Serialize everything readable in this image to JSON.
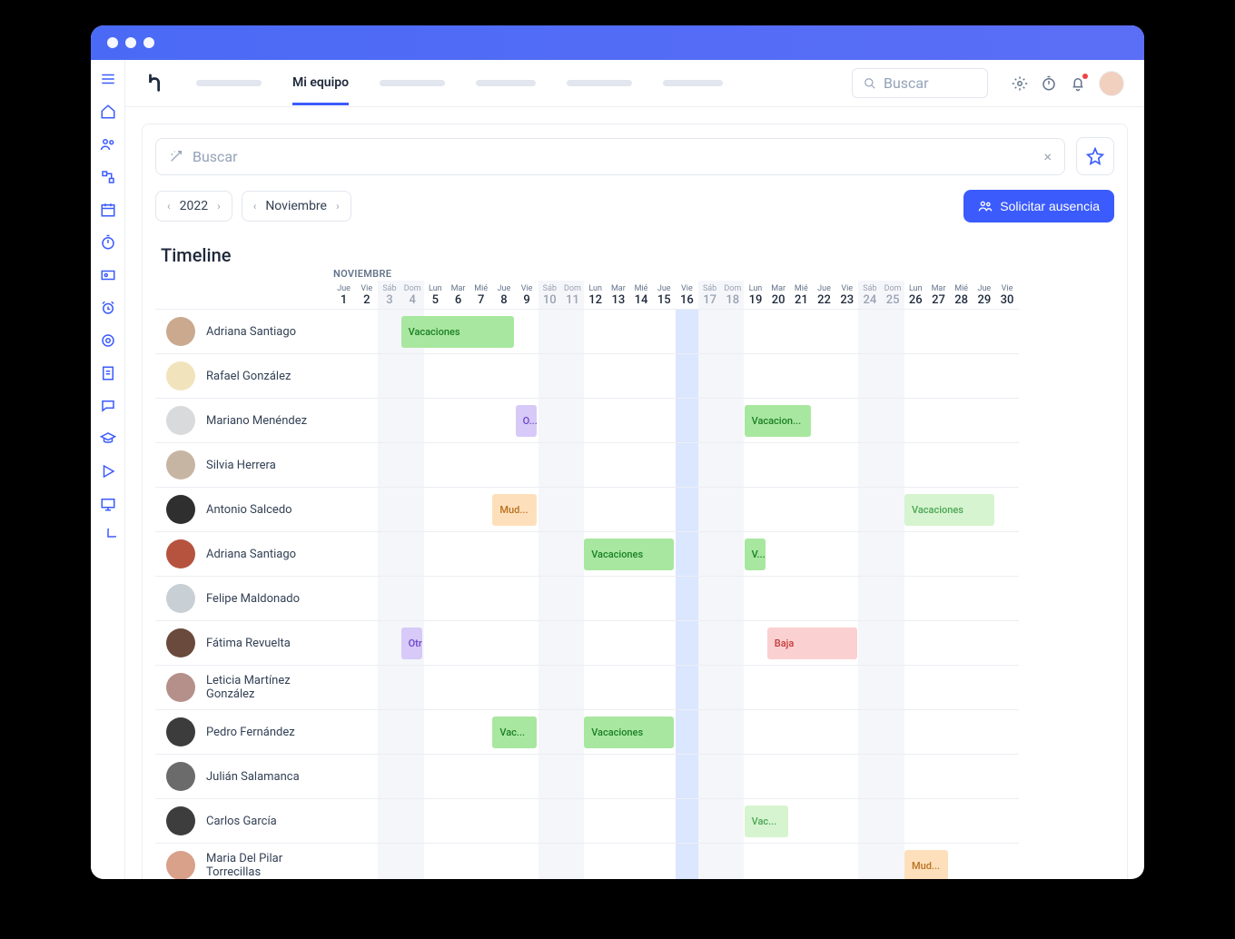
{
  "window": {
    "os_dots": 3
  },
  "topbar": {
    "active_tab": "Mi equipo",
    "search_placeholder": "Buscar"
  },
  "filters": {
    "search_placeholder": "Buscar",
    "year": "2022",
    "month": "Noviembre",
    "request_button": "Solicitar ausencia",
    "clear_glyph": "×"
  },
  "timeline": {
    "title": "Timeline",
    "month_header": "NOVIEMBRE",
    "today_index": 15,
    "days": [
      {
        "dow": "Jue",
        "num": "1",
        "weekend": false
      },
      {
        "dow": "Vie",
        "num": "2",
        "weekend": false
      },
      {
        "dow": "Sáb",
        "num": "3",
        "weekend": true
      },
      {
        "dow": "Dom",
        "num": "4",
        "weekend": true
      },
      {
        "dow": "Lun",
        "num": "5",
        "weekend": false
      },
      {
        "dow": "Mar",
        "num": "6",
        "weekend": false
      },
      {
        "dow": "Mié",
        "num": "7",
        "weekend": false
      },
      {
        "dow": "Jue",
        "num": "8",
        "weekend": false
      },
      {
        "dow": "Vie",
        "num": "9",
        "weekend": false
      },
      {
        "dow": "Sáb",
        "num": "10",
        "weekend": true
      },
      {
        "dow": "Dom",
        "num": "11",
        "weekend": true
      },
      {
        "dow": "Lun",
        "num": "12",
        "weekend": false
      },
      {
        "dow": "Mar",
        "num": "13",
        "weekend": false
      },
      {
        "dow": "Mié",
        "num": "14",
        "weekend": false
      },
      {
        "dow": "Jue",
        "num": "15",
        "weekend": false
      },
      {
        "dow": "Vie",
        "num": "16",
        "weekend": false
      },
      {
        "dow": "Sáb",
        "num": "17",
        "weekend": true
      },
      {
        "dow": "Dom",
        "num": "18",
        "weekend": true
      },
      {
        "dow": "Lun",
        "num": "19",
        "weekend": false
      },
      {
        "dow": "Mar",
        "num": "20",
        "weekend": false
      },
      {
        "dow": "Mié",
        "num": "21",
        "weekend": false
      },
      {
        "dow": "Jue",
        "num": "22",
        "weekend": false
      },
      {
        "dow": "Vie",
        "num": "23",
        "weekend": false
      },
      {
        "dow": "Sáb",
        "num": "24",
        "weekend": true
      },
      {
        "dow": "Dom",
        "num": "25",
        "weekend": true
      },
      {
        "dow": "Lun",
        "num": "26",
        "weekend": false
      },
      {
        "dow": "Mar",
        "num": "27",
        "weekend": false
      },
      {
        "dow": "Mié",
        "num": "28",
        "weekend": false
      },
      {
        "dow": "Jue",
        "num": "29",
        "weekend": false
      },
      {
        "dow": "Vie",
        "num": "30",
        "weekend": false
      }
    ],
    "rows": [
      {
        "name": "Adriana Santiago",
        "avatar": "#caa98e",
        "events": [
          {
            "label": "Vacaciones",
            "start": 3,
            "span": 5,
            "cls": "ev-green"
          }
        ]
      },
      {
        "name": "Rafael González",
        "avatar": "#f1e3bc",
        "events": []
      },
      {
        "name": "Mariano Menéndez",
        "avatar": "#d9dadb",
        "events": [
          {
            "label": "O...",
            "start": 8,
            "span": 1,
            "cls": "ev-purple"
          },
          {
            "label": "Vacacion...",
            "start": 18,
            "span": 3,
            "cls": "ev-green"
          }
        ]
      },
      {
        "name": "Silvia Herrera",
        "avatar": "#c7b5a3",
        "events": []
      },
      {
        "name": "Antonio Salcedo",
        "avatar": "#2f2f2f",
        "events": [
          {
            "label": "Mud...",
            "start": 7,
            "span": 2,
            "cls": "ev-orange"
          },
          {
            "label": "Vacaciones",
            "start": 25,
            "span": 4,
            "cls": "ev-green-l"
          }
        ]
      },
      {
        "name": "Adriana Santiago",
        "avatar": "#b6533f",
        "events": [
          {
            "label": "Vacaciones",
            "start": 11,
            "span": 4,
            "cls": "ev-green"
          },
          {
            "label": "V...",
            "start": 18,
            "span": 1,
            "cls": "ev-green"
          }
        ]
      },
      {
        "name": "Felipe Maldonado",
        "avatar": "#c9d0d5",
        "events": []
      },
      {
        "name": "Fátima Revuelta",
        "avatar": "#6b4a3e",
        "events": [
          {
            "label": "Otro",
            "start": 3,
            "span": 1,
            "cls": "ev-purple"
          },
          {
            "label": "Baja",
            "start": 19,
            "span": 4,
            "cls": "ev-red"
          }
        ]
      },
      {
        "name": "Leticia Martínez González",
        "avatar": "#b5908a",
        "events": []
      },
      {
        "name": "Pedro Fernández",
        "avatar": "#3c3c3c",
        "events": [
          {
            "label": "Vac...",
            "start": 7,
            "span": 2,
            "cls": "ev-green"
          },
          {
            "label": "Vacaciones",
            "start": 11,
            "span": 4,
            "cls": "ev-green"
          }
        ]
      },
      {
        "name": "Julián Salamanca",
        "avatar": "#6b6b6b",
        "events": []
      },
      {
        "name": "Carlos García",
        "avatar": "#3d3d3d",
        "events": [
          {
            "label": "Vac...",
            "start": 18,
            "span": 2,
            "cls": "ev-green-l"
          }
        ]
      },
      {
        "name": "Maria Del Pilar Torrecillas",
        "avatar": "#d9a08a",
        "events": [
          {
            "label": "Mud...",
            "start": 25,
            "span": 2,
            "cls": "ev-orange"
          }
        ]
      }
    ]
  },
  "sidebar_icons": [
    "menu-icon",
    "home-icon",
    "people-icon",
    "org-icon",
    "calendar-icon",
    "stopwatch-icon",
    "id-card-icon",
    "alarm-icon",
    "goal-icon",
    "survey-icon",
    "chat-icon",
    "grad-icon",
    "play-icon",
    "present-icon",
    "pie-icon"
  ]
}
